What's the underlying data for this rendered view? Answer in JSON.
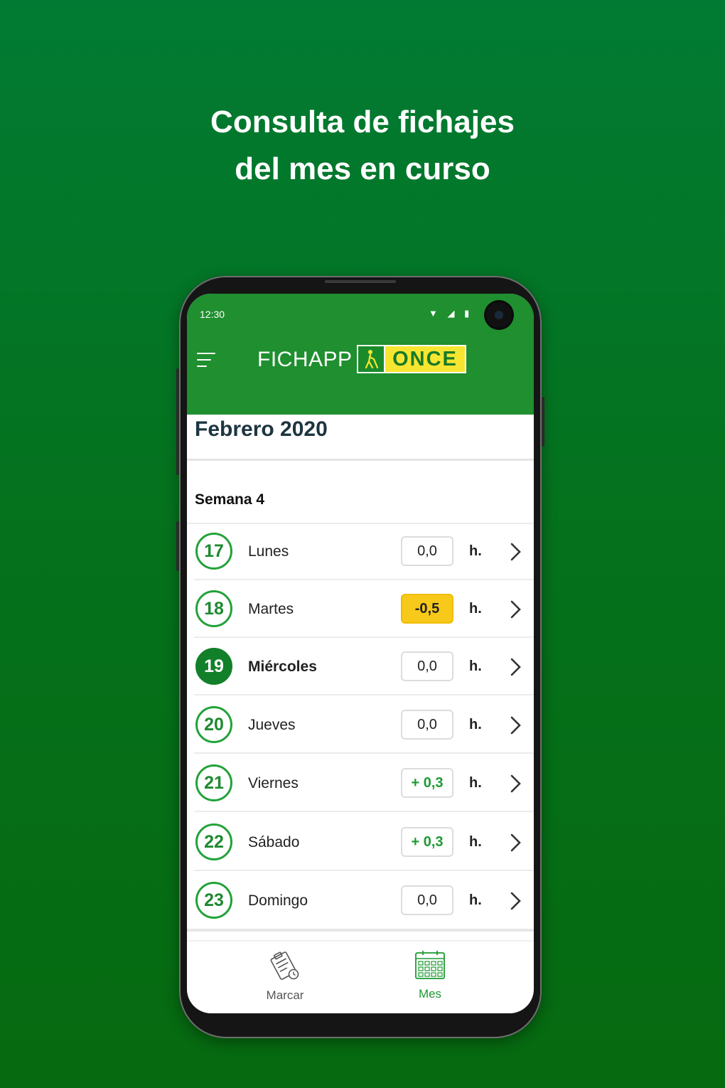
{
  "headline": {
    "line1": "Consulta de fichajes",
    "line2": "del mes en curso"
  },
  "status_bar": {
    "time": "12:30",
    "icons": [
      "wifi-icon",
      "signal-icon",
      "battery-icon"
    ]
  },
  "app_bar": {
    "brand": "FICHAPP",
    "logo_text": "ONCE",
    "menu_icon": "hamburger-menu-icon"
  },
  "calendar": {
    "month_title": "Febrero 2020",
    "week_title": "Semana 4",
    "unit": "h.",
    "days": [
      {
        "number": "17",
        "name": "Lunes",
        "hours": "0,0",
        "state": "normal",
        "current": false
      },
      {
        "number": "18",
        "name": "Martes",
        "hours": "-0,5",
        "state": "negative",
        "current": false
      },
      {
        "number": "19",
        "name": "Miércoles",
        "hours": "0,0",
        "state": "normal",
        "current": true
      },
      {
        "number": "20",
        "name": "Jueves",
        "hours": "0,0",
        "state": "normal",
        "current": false
      },
      {
        "number": "21",
        "name": "Viernes",
        "hours": "+ 0,3",
        "state": "positive",
        "current": false
      },
      {
        "number": "22",
        "name": "Sábado",
        "hours": "+ 0,3",
        "state": "positive",
        "current": false
      },
      {
        "number": "23",
        "name": "Domingo",
        "hours": "0,0",
        "state": "normal",
        "current": false
      }
    ]
  },
  "bottom_nav": {
    "items": [
      {
        "label": "Marcar",
        "icon": "clipboard-clock-icon",
        "active": false
      },
      {
        "label": "Mes",
        "icon": "calendar-grid-icon",
        "active": true
      }
    ]
  },
  "colors": {
    "background": "#047425",
    "app_bar": "#1f8f2f",
    "accent_green": "#1e8a31",
    "negative_badge": "#f7c91a",
    "logo_yellow": "#f7e631"
  }
}
